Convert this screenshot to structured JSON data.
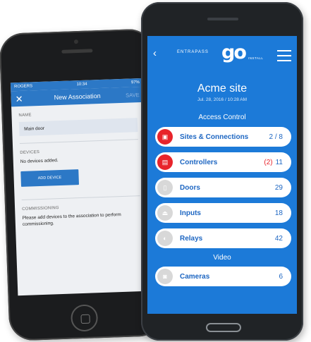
{
  "ios": {
    "status": {
      "carrier": "ROGERS",
      "time": "10:34",
      "battery": "97%"
    },
    "nav": {
      "close_icon": "close-icon",
      "title": "New Association",
      "save_label": "SAVE"
    },
    "name_section": {
      "label": "NAME",
      "value": "Main door"
    },
    "devices_section": {
      "label": "DEVICES",
      "empty_text": "No devices added.",
      "add_button": "ADD DEVICE"
    },
    "commissioning_section": {
      "label": "COMMISSIONING",
      "text": "Please add devices to the association to perform commissioning."
    }
  },
  "android": {
    "header": {
      "brand": "ENTRAPASS",
      "logo": "go",
      "logo_suffix": "INSTALL",
      "back_icon": "chevron-left-icon",
      "menu_icon": "hamburger-menu-icon"
    },
    "site": {
      "name": "Acme site",
      "datetime": "Jul. 28, 2016 / 10:28 AM"
    },
    "access_control": {
      "title": "Access Control",
      "items": [
        {
          "label": "Sites & Connections",
          "count": "2 / 8",
          "alert": "",
          "icon": "building-icon",
          "icon_color": "#e8242b"
        },
        {
          "label": "Controllers",
          "count": "11",
          "alert": "(2)",
          "icon": "controller-icon",
          "icon_color": "#e8242b"
        },
        {
          "label": "Doors",
          "count": "29",
          "alert": "",
          "icon": "door-icon",
          "icon_color": "#d8d8d8"
        },
        {
          "label": "Inputs",
          "count": "18",
          "alert": "",
          "icon": "input-icon",
          "icon_color": "#d8d8d8"
        },
        {
          "label": "Relays",
          "count": "42",
          "alert": "",
          "icon": "relay-icon",
          "icon_color": "#d8d8d8"
        }
      ]
    },
    "video": {
      "title": "Video",
      "items": [
        {
          "label": "Cameras",
          "count": "6",
          "icon": "camera-icon",
          "icon_color": "#d8d8d8"
        }
      ]
    }
  },
  "colors": {
    "ios_accent": "#2c78c6",
    "android_bg": "#1c7ad8",
    "alert": "#e8242b",
    "item_text": "#1d66c2"
  }
}
